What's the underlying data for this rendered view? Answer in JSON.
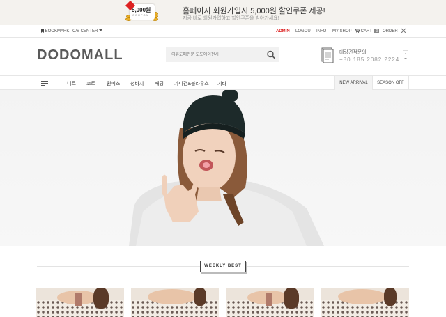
{
  "promo": {
    "coupon_amount": "5,000원",
    "coupon_label": "COUPON",
    "title": "홈페이지 회원가입시 5,000원 할인쿠폰 제공!",
    "subtitle": "지금 바로 회원가입하고 할인쿠폰을 받아가세요!"
  },
  "topbar": {
    "bookmark": "BOOKMARK",
    "cs_center": "C/S CENTER",
    "admin": "ADMIN",
    "logout": "LOGOUT",
    "info": "INFO",
    "my_shop": "MY SHOP",
    "cart": "CART",
    "cart_count": "0",
    "order": "ORDER"
  },
  "header": {
    "logo": "DODOMALL",
    "search_placeholder": "의류도매전문 도도에이전시",
    "tel_label": "대량견적문의",
    "tel_number": "+80 185 2082 2224"
  },
  "nav": {
    "items": [
      "니트",
      "코트",
      "원피스",
      "청바지",
      "패딩",
      "가디건&블라우스",
      "기타"
    ],
    "new_arrival": "NEW ARRIVAL",
    "season_off": "SEASON OFF"
  },
  "section": {
    "weekly_best": "WEEKLY BEST"
  },
  "colors": {
    "accent_red": "#dd2222",
    "logo_gray": "#5a5a5a",
    "promo_bg": "#f4f2ee"
  }
}
